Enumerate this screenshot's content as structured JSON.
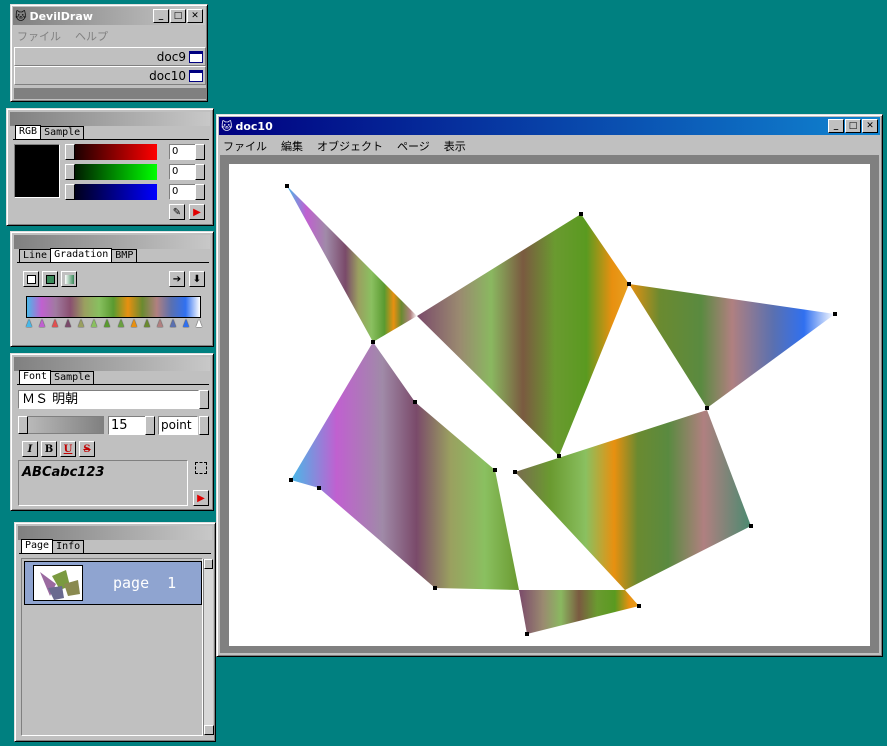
{
  "main_app": {
    "title": "DevilDraw",
    "menu": [
      "ファイル",
      "ヘルプ"
    ],
    "documents": [
      {
        "label": "doc9"
      },
      {
        "label": "doc10"
      }
    ]
  },
  "rgb_panel": {
    "tabs": [
      "RGB",
      "Sample"
    ],
    "values": {
      "r": "0",
      "g": "0",
      "b": "0"
    },
    "colors": {
      "preview": "#000000",
      "red": "#ff0000",
      "green": "#00ff00",
      "blue": "#0000ff"
    }
  },
  "gradation_panel": {
    "tabs": [
      "Line",
      "Gradation",
      "BMP"
    ],
    "stop_count": 14
  },
  "font_panel": {
    "tabs": [
      "Font",
      "Sample"
    ],
    "font_name": "ＭＳ 明朝",
    "size": "15",
    "unit": "point",
    "styles": [
      "I",
      "B",
      "U",
      "S"
    ],
    "sample_text": "ABCabc123"
  },
  "page_panel": {
    "tabs": [
      "Page",
      "Info"
    ],
    "pages": [
      {
        "label": "page  1"
      }
    ]
  },
  "doc_window": {
    "title": "doc10",
    "menu": [
      "ファイル",
      "編集",
      "オブジェクト",
      "ページ",
      "表示"
    ]
  }
}
